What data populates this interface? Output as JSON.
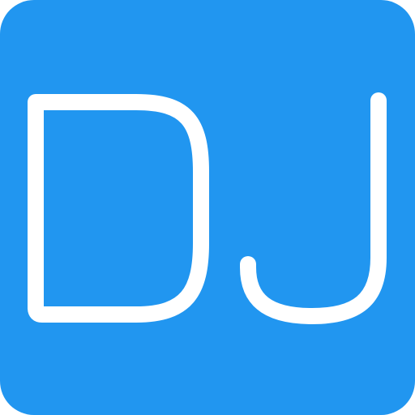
{
  "icon": {
    "name": "dj-app-icon",
    "monogram": "DJ",
    "letters": [
      "D",
      "J"
    ],
    "background_color": "#2196F0",
    "foreground_color": "#FFFFFF"
  }
}
